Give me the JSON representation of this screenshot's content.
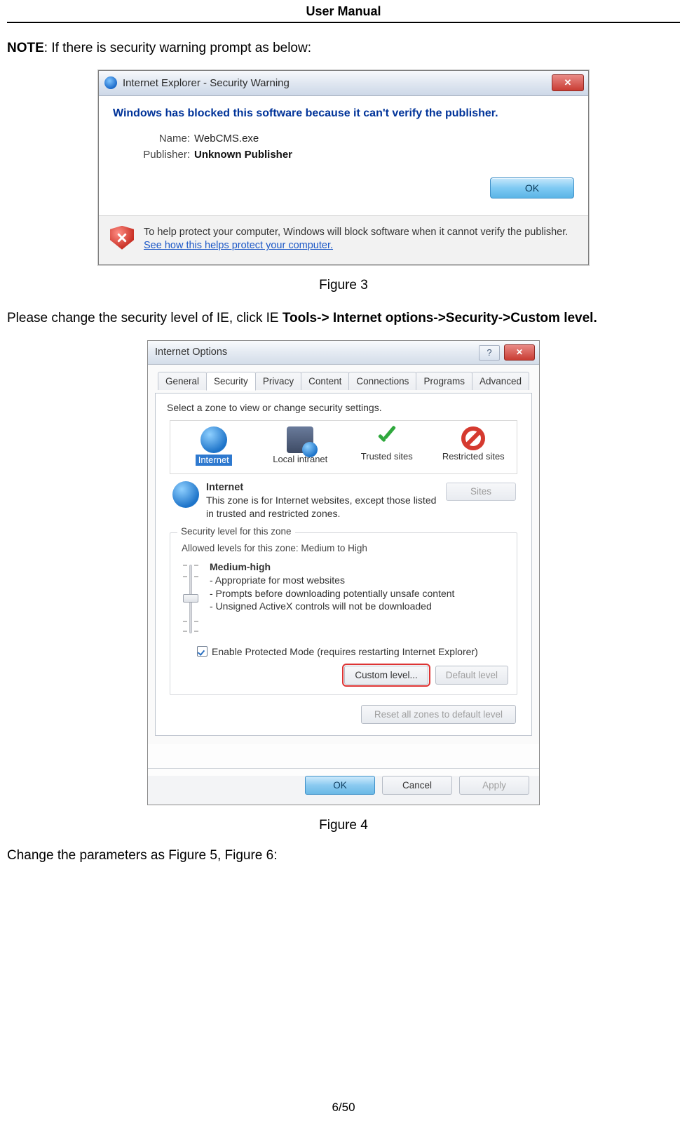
{
  "header": {
    "title": "User Manual"
  },
  "note": {
    "label": "NOTE",
    "text": ": If there is security warning prompt as below:"
  },
  "fig3": {
    "caption": "Figure 3",
    "title": "Internet Explorer - Security Warning",
    "close_glyph": "✕",
    "heading": "Windows has blocked this software because it can't verify the publisher.",
    "name_label": "Name:",
    "name_value": "WebCMS.exe",
    "publisher_label": "Publisher:",
    "publisher_value": "Unknown Publisher",
    "ok_label": "OK",
    "footer_text": "To help protect your computer, Windows will block software when it cannot verify the publisher. ",
    "footer_link": "See how this helps protect your computer."
  },
  "mid_text": {
    "lead": "Please change the security level of IE, click IE ",
    "bold": "Tools-> Internet options->Security->Custom level."
  },
  "fig4": {
    "caption": "Figure 4",
    "title": "Internet Options",
    "help_glyph": "?",
    "close_glyph": "✕",
    "tabs": [
      "General",
      "Security",
      "Privacy",
      "Content",
      "Connections",
      "Programs",
      "Advanced"
    ],
    "active_tab_index": 1,
    "zone_select_label": "Select a zone to view or change security settings.",
    "zones": [
      "Internet",
      "Local intranet",
      "Trusted sites",
      "Restricted sites"
    ],
    "selected_zone_index": 0,
    "zone_desc": {
      "name": "Internet",
      "text": "This zone is for Internet websites, except those listed in trusted and restricted zones."
    },
    "sites_label": "Sites",
    "group_title": "Security level for this zone",
    "allowed_text": "Allowed levels for this zone: Medium to High",
    "level": {
      "name": "Medium-high",
      "b1": "- Appropriate for most websites",
      "b2": "- Prompts before downloading potentially unsafe content",
      "b3": "- Unsigned ActiveX controls will not be downloaded"
    },
    "protected_mode": "Enable Protected Mode (requires restarting Internet Explorer)",
    "custom_level_label": "Custom level...",
    "default_level_label": "Default level",
    "reset_label": "Reset all zones to default level",
    "ok_label": "OK",
    "cancel_label": "Cancel",
    "apply_label": "Apply"
  },
  "tail_text": "Change the parameters as Figure 5, Figure 6:",
  "page_number": "6/50"
}
